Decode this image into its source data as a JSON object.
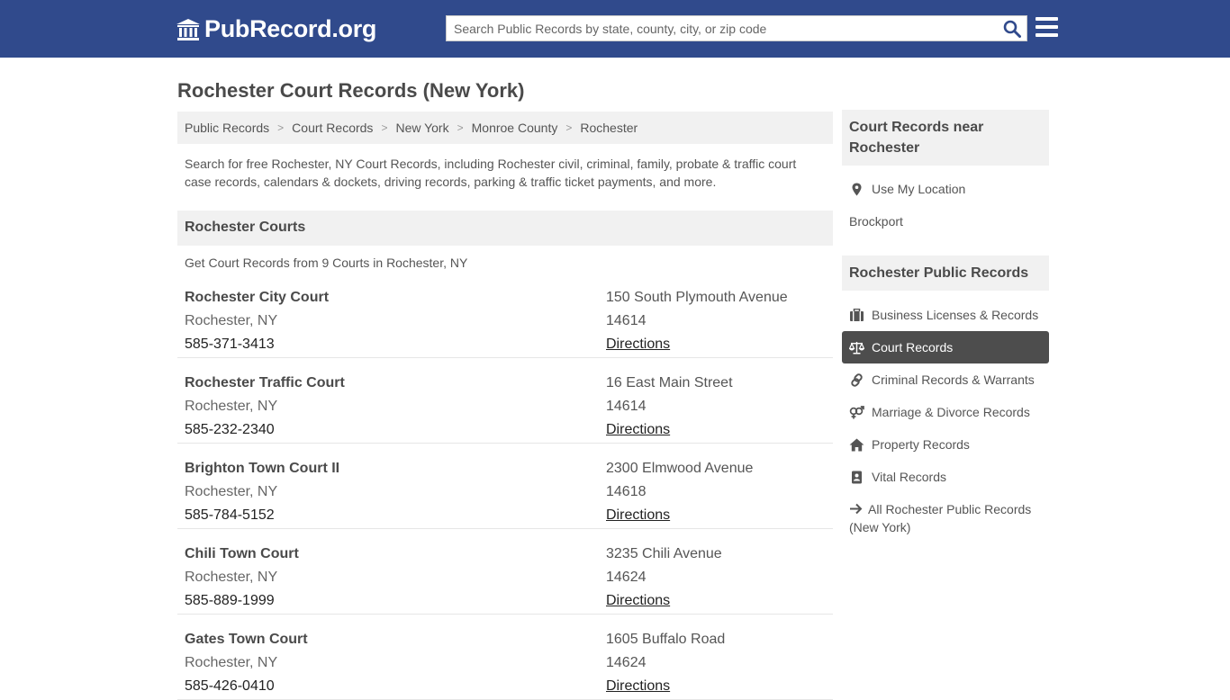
{
  "header": {
    "logo_text": "PubRecord.org",
    "search_placeholder": "Search Public Records by state, county, city, or zip code"
  },
  "page_title": "Rochester Court Records (New York)",
  "breadcrumb": [
    "Public Records",
    "Court Records",
    "New York",
    "Monroe County",
    "Rochester"
  ],
  "intro": "Search for free Rochester, NY Court Records, including Rochester civil, criminal, family, probate & traffic court case records, calendars & dockets, driving records, parking & traffic ticket payments, and more.",
  "courts_section": {
    "title": "Rochester Courts",
    "subtitle": "Get Court Records from 9 Courts in Rochester, NY",
    "courts": [
      {
        "name": "Rochester City Court",
        "city_state": "Rochester, NY",
        "phone": "585-371-3413",
        "street": "150 South Plymouth Avenue",
        "zip": "14614",
        "directions": "Directions"
      },
      {
        "name": "Rochester Traffic Court",
        "city_state": "Rochester, NY",
        "phone": "585-232-2340",
        "street": "16 East Main Street",
        "zip": "14614",
        "directions": "Directions"
      },
      {
        "name": "Brighton Town Court II",
        "city_state": "Rochester, NY",
        "phone": "585-784-5152",
        "street": "2300 Elmwood Avenue",
        "zip": "14618",
        "directions": "Directions"
      },
      {
        "name": "Chili Town Court",
        "city_state": "Rochester, NY",
        "phone": "585-889-1999",
        "street": "3235 Chili Avenue",
        "zip": "14624",
        "directions": "Directions"
      },
      {
        "name": "Gates Town Court",
        "city_state": "Rochester, NY",
        "phone": "585-426-0410",
        "street": "1605 Buffalo Road",
        "zip": "14624",
        "directions": "Directions"
      }
    ]
  },
  "sidebar": {
    "nearby_title": "Court Records near Rochester",
    "use_location": "Use My Location",
    "nearby_city": "Brockport",
    "public_records_title": "Rochester Public Records",
    "items": [
      {
        "label": "Business Licenses & Records",
        "icon": "briefcase-icon"
      },
      {
        "label": "Court Records",
        "icon": "scales-icon",
        "active": true
      },
      {
        "label": "Criminal Records & Warrants",
        "icon": "link-icon"
      },
      {
        "label": "Marriage & Divorce Records",
        "icon": "gender-icon"
      },
      {
        "label": "Property Records",
        "icon": "home-icon"
      },
      {
        "label": "Vital Records",
        "icon": "vital-record-icon"
      }
    ],
    "all_records": "All Rochester Public Records (New York)"
  },
  "colors": {
    "header_bg": "#304a8c",
    "active_item_bg": "#4d4d4d",
    "panel_bg": "#f1f1f1"
  }
}
